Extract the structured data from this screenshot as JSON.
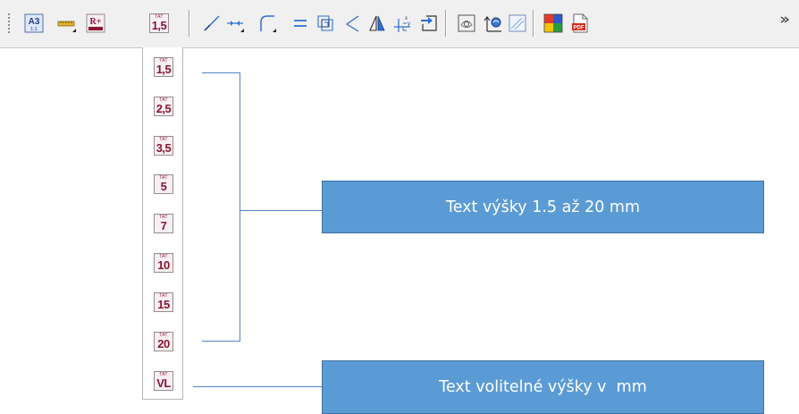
{
  "toolbar": {
    "buttons": [
      {
        "icon": "a3-paper-format-icon",
        "label": "A3",
        "sub": "1:1"
      },
      {
        "icon": "ruler-icon"
      },
      {
        "icon": "r-plus-icon",
        "label": "R+"
      },
      {
        "icon": "text-height-icon",
        "top": "TAT",
        "value": "1,5"
      },
      {
        "icon": "line-icon"
      },
      {
        "icon": "dimension-icon"
      },
      {
        "icon": "arc-icon"
      },
      {
        "icon": "parallel-lines-icon"
      },
      {
        "icon": "offset-copy-icon"
      },
      {
        "icon": "angle-icon"
      },
      {
        "icon": "mirror-icon"
      },
      {
        "icon": "axes-xy-icon"
      },
      {
        "icon": "insert-block-icon"
      },
      {
        "icon": "hatch-detail-icon"
      },
      {
        "icon": "rotate-3d-icon"
      },
      {
        "icon": "image-frame-icon"
      },
      {
        "icon": "color-palette-icon"
      },
      {
        "icon": "pdf-export-icon",
        "label": "PDF"
      }
    ]
  },
  "dropdown": {
    "items": [
      {
        "top": "TAT",
        "value": "1,5"
      },
      {
        "top": "TAT",
        "value": "2,5"
      },
      {
        "top": "TAT",
        "value": "3,5"
      },
      {
        "top": "TAT",
        "value": "5"
      },
      {
        "top": "TAT",
        "value": "7"
      },
      {
        "top": "TAT",
        "value": "10"
      },
      {
        "top": "TAT",
        "value": "15"
      },
      {
        "top": "TAT",
        "value": "20"
      },
      {
        "top": "TAT",
        "value": "VL"
      }
    ]
  },
  "annotations": {
    "callout_heights": "Text výšky 1.5 až 20 mm",
    "callout_custom": "Text volitelné výšky v  mm"
  },
  "colors": {
    "tat_text": "#8a1535",
    "callout_fill": "#5b9bd5",
    "callout_border": "#41719c",
    "bracket": "#4f86c6"
  }
}
